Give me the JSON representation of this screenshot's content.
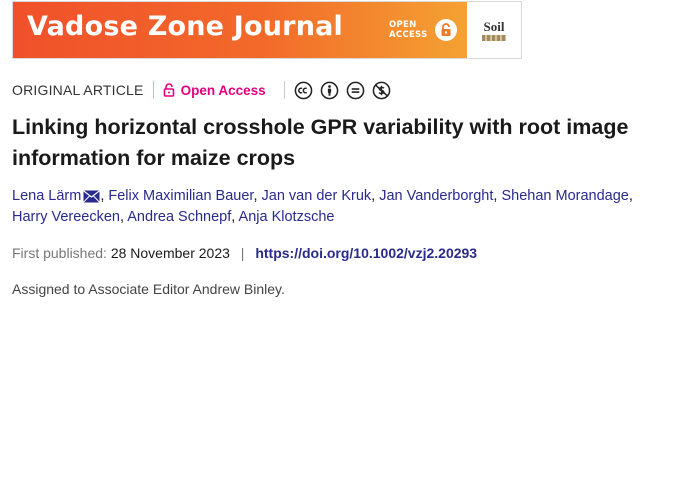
{
  "banner": {
    "journal_title": "Vadose Zone Journal",
    "open_access_line1": "OPEN",
    "open_access_line2": "ACCESS",
    "society_logo_text": "Soil",
    "brand_colors": [
      "#f0502a",
      "#f4a233"
    ]
  },
  "meta": {
    "article_type": "ORIGINAL ARTICLE",
    "open_access_label": "Open Access",
    "license_icons": [
      "creative-commons-icon",
      "attribution-icon",
      "no-derivatives-icon",
      "non-commercial-icon"
    ],
    "accent_color": "#e6007e"
  },
  "article": {
    "title": "Linking horizontal crosshole GPR variability with root image information for maize crops"
  },
  "authors": [
    "Lena Lärm",
    "Felix Maximilian Bauer",
    "Jan van der Kruk",
    "Jan Vanderborght",
    "Shehan Morandage",
    "Harry Vereecken",
    "Andrea Schnepf",
    "Anja Klotzsche"
  ],
  "publication": {
    "first_published_label": "First published:",
    "date": "28 November 2023",
    "separator": "|",
    "doi": "https://doi.org/10.1002/vzj2.20293"
  },
  "note": "Assigned to Associate Editor Andrew Binley."
}
